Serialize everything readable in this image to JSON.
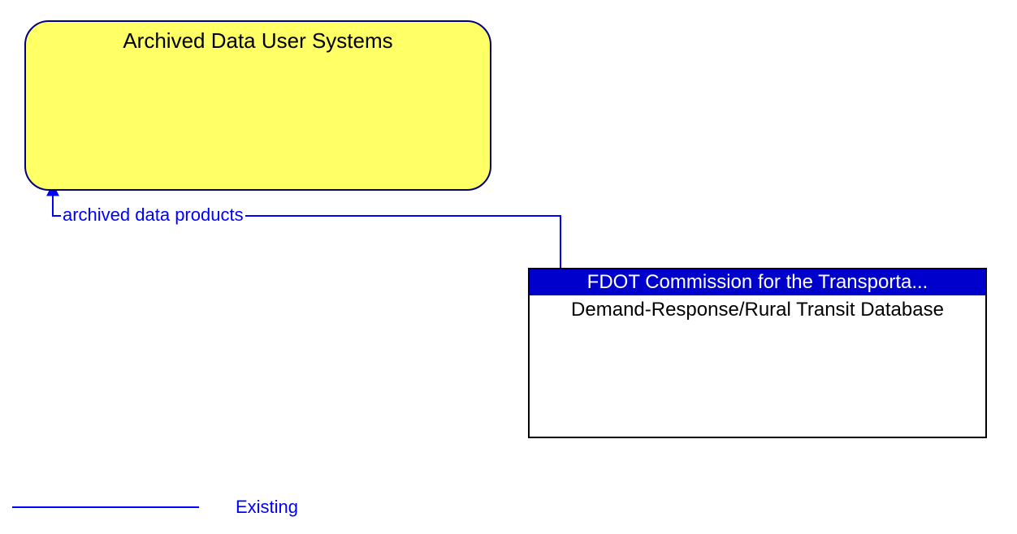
{
  "nodes": {
    "archived_data_user_systems": {
      "title": "Archived Data User Systems"
    },
    "database_node": {
      "header": "FDOT Commission for the Transporta...",
      "body": "Demand-Response/Rural Transit Database"
    }
  },
  "flows": {
    "archived_data_products": {
      "label": "archived data products"
    }
  },
  "legend": {
    "existing": "Existing"
  },
  "colors": {
    "yellow_fill": "#ffff66",
    "navy_border": "#000080",
    "blue_header": "#0000cc",
    "blue_text": "#0000ff"
  }
}
